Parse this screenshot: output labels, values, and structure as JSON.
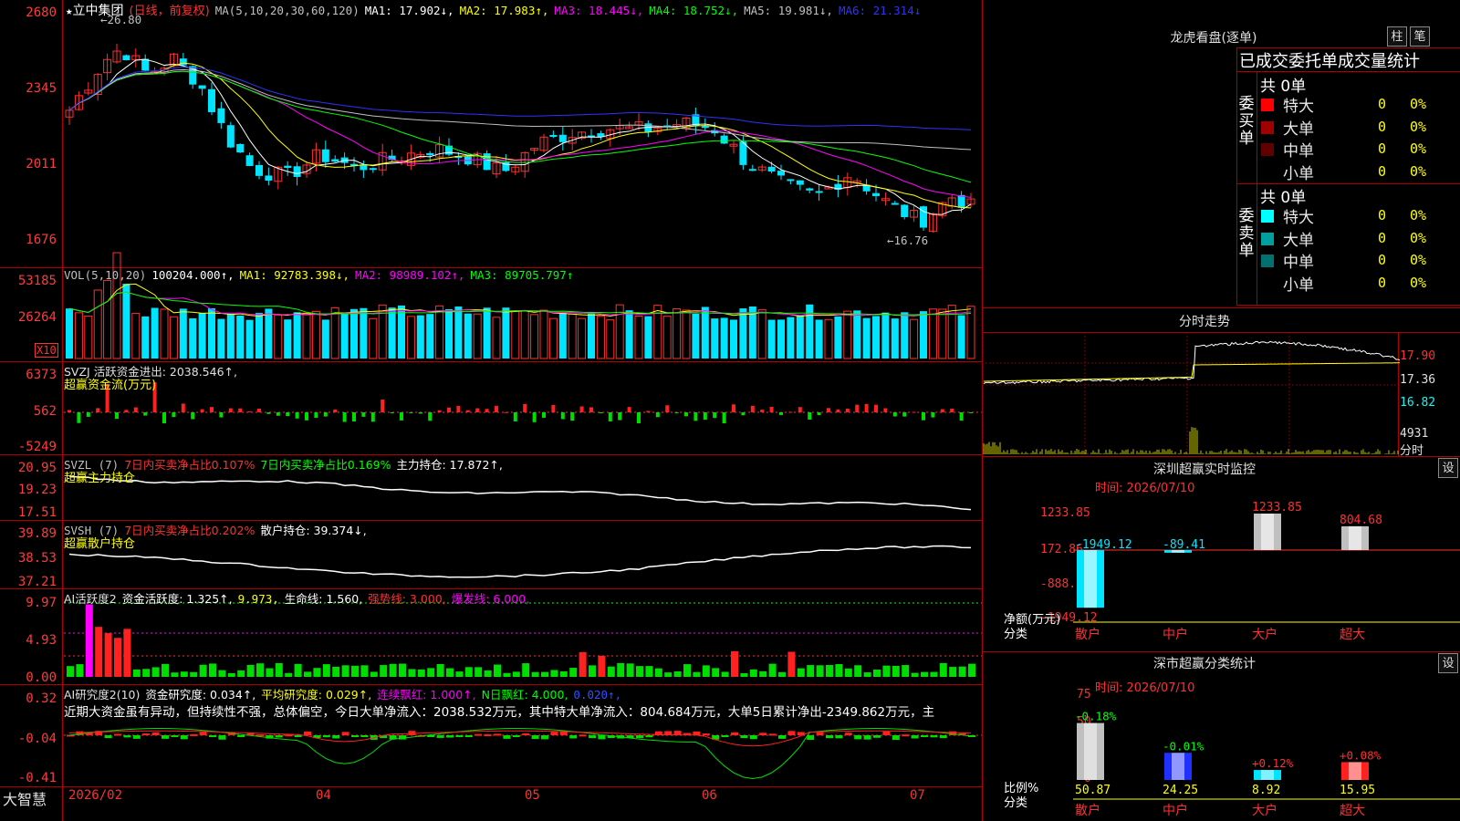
{
  "stock": {
    "title": "立中集团",
    "mode": "(日线，前复权)",
    "star": "★"
  },
  "main_legend": {
    "ma_label": "MA(5,10,20,30,60,120)",
    "items": [
      {
        "text": "MA1: 17.902↓,",
        "color": "#ffffff"
      },
      {
        "text": "MA2: 17.983↑,",
        "color": "#ffff00"
      },
      {
        "text": "MA3: 18.445↓,",
        "color": "#ff00ff"
      },
      {
        "text": "MA4: 18.752↓,",
        "color": "#00ff00"
      },
      {
        "text": "MA5: 19.981↓,",
        "color": "#c0c0c0"
      },
      {
        "text": "MA6: 21.314↓",
        "color": "#3030ff"
      }
    ],
    "hi_marker": "26.80",
    "lo_marker": "16.76"
  },
  "price_axis": [
    "2680",
    "2345",
    "2011",
    "1676"
  ],
  "vol_legend": {
    "label": "VOL(5,10,20)",
    "items": [
      {
        "text": "100204.000↑,",
        "color": "#ffffff"
      },
      {
        "text": "MA1: 92783.398↓,",
        "color": "#ffff00"
      },
      {
        "text": "MA2: 98989.102↑,",
        "color": "#ff00ff"
      },
      {
        "text": "MA3: 89705.797↑",
        "color": "#00ff00"
      }
    ],
    "axis": [
      "53185",
      "26264"
    ],
    "unit": "X10"
  },
  "svzj": {
    "line1": "SVZJ  活跃资金进出: 2038.546↑,",
    "line2": "超赢资金流(万元)",
    "axis": [
      "6373",
      "562",
      "-5249"
    ]
  },
  "svzl": {
    "p1": "SVZL (7)",
    "p2": "7日内买卖净占比0.107%",
    "p3": "7日内买卖净占比0.169%",
    "p4": "主力持仓: 17.872↑,",
    "line2": "超赢主力持仓",
    "axis": [
      "20.95",
      "19.23",
      "17.51"
    ]
  },
  "svsh": {
    "p1": "SVSH (7)",
    "p2": "7日内买卖净占比0.202%",
    "p3": "散户持仓: 39.374↓,",
    "line2": "超赢散户持仓",
    "axis": [
      "39.89",
      "38.53",
      "37.21"
    ]
  },
  "ai_active": {
    "p1": "AI活跃度2",
    "p2": "资金活跃度: 1.325↑,",
    "p3": "9.973,",
    "p4": "生命线: 1.560,",
    "p5": "强势线: 3.000,",
    "p6": "爆发线: 6.000,",
    "axis": [
      "9.97",
      "4.93",
      "0.00"
    ]
  },
  "ai_research": {
    "p1": "AI研究度2(10)",
    "p2": "资金研究度: 0.034↑,",
    "p3": "平均研究度: 0.029↑,",
    "p4": "连续飘红: 1.000↑,",
    "p5": "N日飘红: 4.000,",
    "p6": "0.020↑,",
    "comment": "近期大资金虽有异动，但持续性不强，总体偏空，今日大单净流入：2038.532万元，其中特大单净流入：804.684万元，大单5日累计净出-2349.862万元，主",
    "axis": [
      "0.32",
      "-0.04",
      "-0.41"
    ]
  },
  "date_axis": [
    "2026/02",
    "04",
    "05",
    "06",
    "07"
  ],
  "brand": "大智慧",
  "dragon": {
    "title": "龙虎看盘(逐单)",
    "btn1": "柱",
    "btn2": "笔",
    "header": "已成交委托单成交量统计",
    "buy_label": "委买单",
    "sell_label": "委卖单",
    "buy_total": "共 0单",
    "sell_total": "共 0单",
    "buy_rows": [
      {
        "label": "特大",
        "count": "0",
        "pct": "0%",
        "color": "#ff0000"
      },
      {
        "label": "大单",
        "count": "0",
        "pct": "0%",
        "color": "#a00000"
      },
      {
        "label": "中单",
        "count": "0",
        "pct": "0%",
        "color": "#600000"
      },
      {
        "label": "小单",
        "count": "0",
        "pct": "0%",
        "color": ""
      }
    ],
    "sell_rows": [
      {
        "label": "特大",
        "count": "0",
        "pct": "0%",
        "color": "#00ffff"
      },
      {
        "label": "大单",
        "count": "0",
        "pct": "0%",
        "color": "#00a0a0"
      },
      {
        "label": "中单",
        "count": "0",
        "pct": "0%",
        "color": "#007070"
      },
      {
        "label": "小单",
        "count": "0",
        "pct": "0%",
        "color": ""
      }
    ]
  },
  "intraday": {
    "title": "分时走势",
    "price_axis": [
      "17.90",
      "17.36",
      "16.82"
    ],
    "vol_label": "4931",
    "vol_unit": "分时"
  },
  "sz_monitor": {
    "title": "深圳超赢实时监控",
    "btn": "设",
    "time": "时间: 2026/07/10",
    "axis": [
      "1233.85",
      "172.86",
      "-888.13",
      "-1949.12"
    ],
    "ylabel": "净额(万元)",
    "xlabel": "分类",
    "categories": [
      "散户",
      "中户",
      "大户",
      "超大"
    ],
    "values": [
      -1949.12,
      -89.41,
      1233.85,
      804.68
    ],
    "value_labels": [
      "-1949.12",
      "-89.41",
      "1233.85",
      "804.68"
    ]
  },
  "sz_class": {
    "title": "深市超赢分类统计",
    "btn": "设",
    "time": "时间: 2026/07/10",
    "axis": [
      "75",
      "50",
      "25",
      "0"
    ],
    "ylabel": "比例%",
    "xlabel": "分类",
    "categories": [
      "散户",
      "中户",
      "大户",
      "超大"
    ],
    "values": [
      50.87,
      24.25,
      8.92,
      15.95
    ],
    "value_labels": [
      "50.87",
      "24.25",
      "8.92",
      "15.95"
    ],
    "changes": [
      "-0.18%",
      "-0.01%",
      "+0.12%",
      "+0.08%"
    ]
  }
}
